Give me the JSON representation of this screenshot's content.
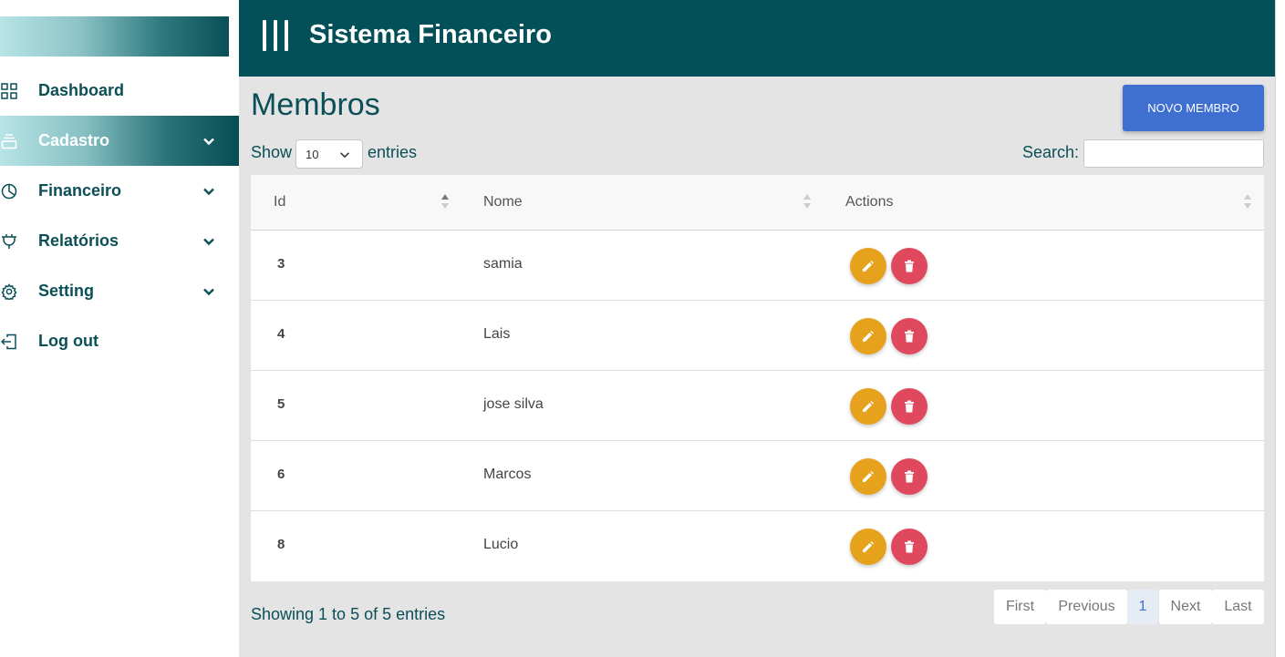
{
  "sidebar": {
    "items": [
      {
        "label": "Dashboard",
        "icon": "grid-icon"
      },
      {
        "label": "Cadastro",
        "icon": "layers-icon",
        "active": true
      },
      {
        "label": "Financeiro",
        "icon": "pie-chart-icon"
      },
      {
        "label": "Relatórios",
        "icon": "plug-icon"
      },
      {
        "label": "Setting",
        "icon": "gear-icon"
      },
      {
        "label": "Log out",
        "icon": "logout-icon"
      }
    ]
  },
  "header": {
    "title": "Sistema Financeiro"
  },
  "main": {
    "title": "Membros",
    "new_button": "Novo Membro",
    "show_label": "Show",
    "entries_value": "10",
    "entries_label": "entries",
    "search_label": "Search:",
    "search_value": ""
  },
  "table": {
    "columns": [
      "Id",
      "Nome",
      "Actions"
    ],
    "rows": [
      {
        "id": "3",
        "nome": "samia"
      },
      {
        "id": "4",
        "nome": "Lais"
      },
      {
        "id": "5",
        "nome": "jose silva"
      },
      {
        "id": "6",
        "nome": "Marcos"
      },
      {
        "id": "8",
        "nome": "Lucio"
      }
    ]
  },
  "footer": {
    "info": "Showing 1 to 5 of 5 entries",
    "pager": {
      "first": "First",
      "previous": "Previous",
      "current": "1",
      "next": "Next",
      "last": "Last"
    }
  },
  "colors": {
    "primary": "#045059",
    "accent": "#3f6fd1",
    "edit": "#e6a11d",
    "delete": "#e0485e"
  }
}
